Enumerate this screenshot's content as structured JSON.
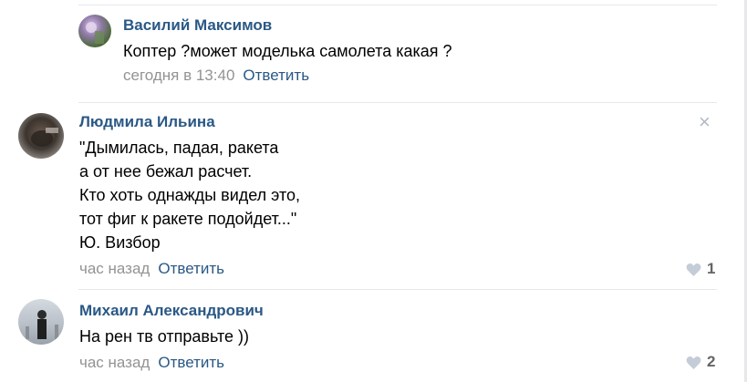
{
  "comments": [
    {
      "author": "Василий Максимов",
      "text": [
        "Коптер ?может моделька самолета какая ?"
      ],
      "time": "сегодня в 13:40",
      "reply_label": "Ответить",
      "likes": ""
    },
    {
      "author": "Людмила Ильина",
      "text": [
        "\"Дымилась, падая, ракета",
        "а от нее бежал расчет.",
        "Кто хоть однажды видел это,",
        "тот фиг к ракете подойдет...\"",
        "Ю. Визбор"
      ],
      "time": "час назад",
      "reply_label": "Ответить",
      "likes": "1",
      "close_icon": "×"
    },
    {
      "author": "Михаил Александрович",
      "text": [
        "На рен тв отправьте ))"
      ],
      "time": "час назад",
      "reply_label": "Ответить",
      "likes": "2"
    }
  ],
  "colors": {
    "link": "#2a5885",
    "meta": "#939393",
    "divider": "#e7e8ec"
  }
}
